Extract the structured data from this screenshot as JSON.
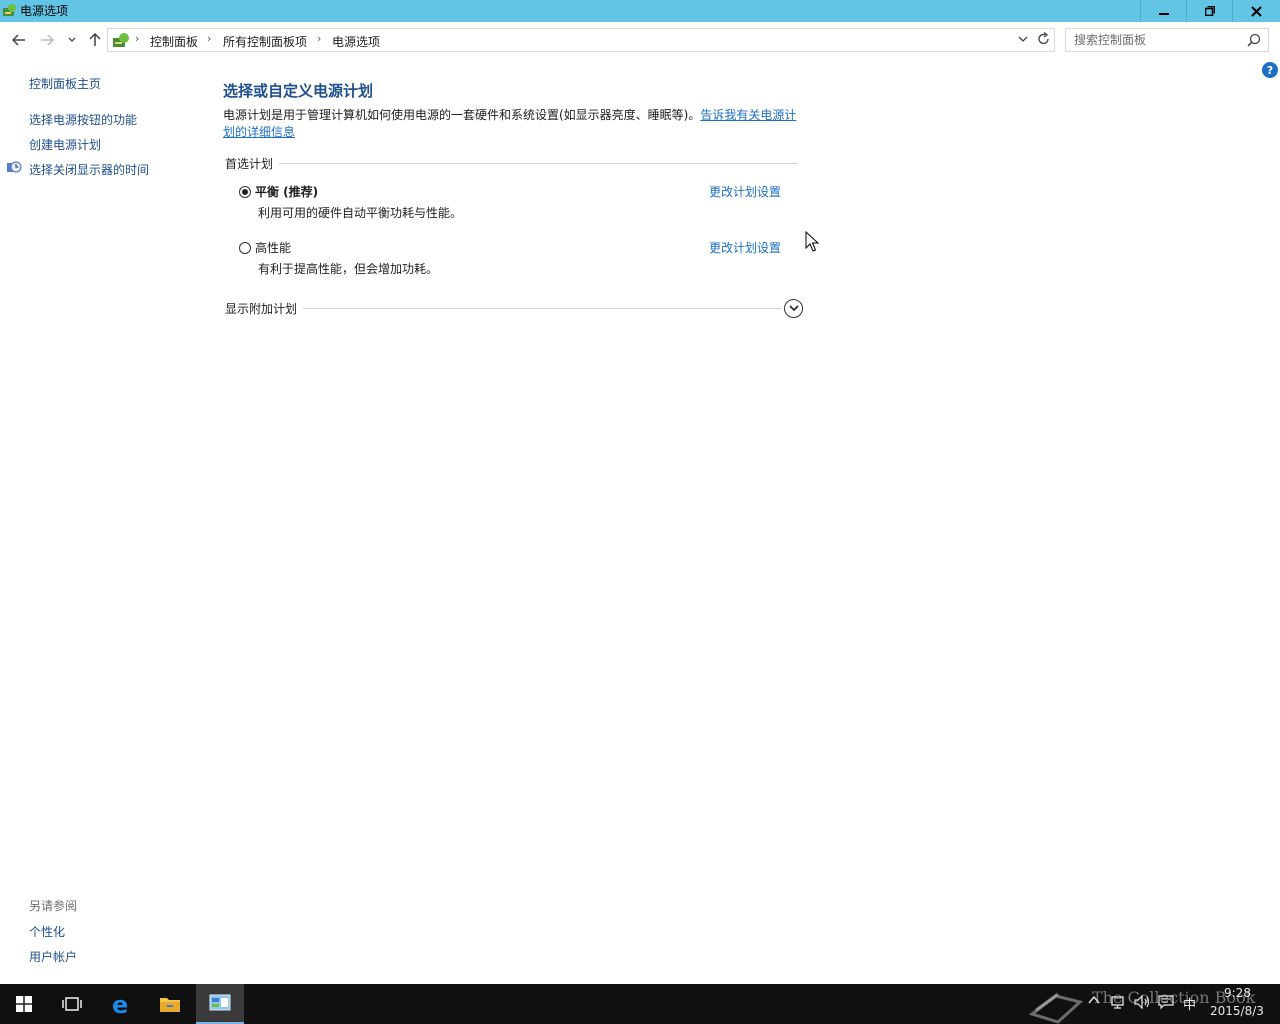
{
  "window": {
    "title": "电源选项",
    "minimize": "🗕",
    "restore": "🗗",
    "close": "✕"
  },
  "nav": {
    "back": "←",
    "forward": "→",
    "recent": "⌄",
    "up": "↑"
  },
  "address": {
    "crumbs": [
      "控制面板",
      "所有控制面板项",
      "电源选项"
    ],
    "separator": "›",
    "dropdown": "⌄",
    "refresh": "↻"
  },
  "search": {
    "placeholder": "搜索控制面板"
  },
  "help": "?",
  "sidebar": {
    "items": [
      {
        "label": "控制面板主页"
      },
      {
        "label": "选择电源按钮的功能"
      },
      {
        "label": "创建电源计划"
      },
      {
        "label": "选择关闭显示器的时间"
      }
    ],
    "see_also_title": "另请参阅",
    "see_also": [
      {
        "label": "个性化"
      },
      {
        "label": "用户帐户"
      }
    ]
  },
  "main": {
    "title": "选择或自定义电源计划",
    "description": "电源计划是用于管理计算机如何使用电源的一套硬件和系统设置(如显示器亮度、睡眠等)。",
    "description_link": "告诉我有关电源计划的详细信息",
    "preferred_label": "首选计划",
    "plans": [
      {
        "name": "平衡 (推荐)",
        "description": "利用可用的硬件自动平衡功耗与性能。",
        "link": "更改计划设置",
        "selected": true
      },
      {
        "name": "高性能",
        "description": "有利于提高性能，但会增加功耗。",
        "link": "更改计划设置",
        "selected": false
      }
    ],
    "additional_label": "显示附加计划"
  },
  "taskbar": {
    "watermark": "The Collection Book",
    "tray_ime": "中",
    "time": "9:28",
    "date": "2015/8/3"
  },
  "colors": {
    "titlebar": "#63c5e6",
    "link": "#1c6fc4",
    "heading": "#1e4f8c",
    "taskbar": "#101010"
  }
}
